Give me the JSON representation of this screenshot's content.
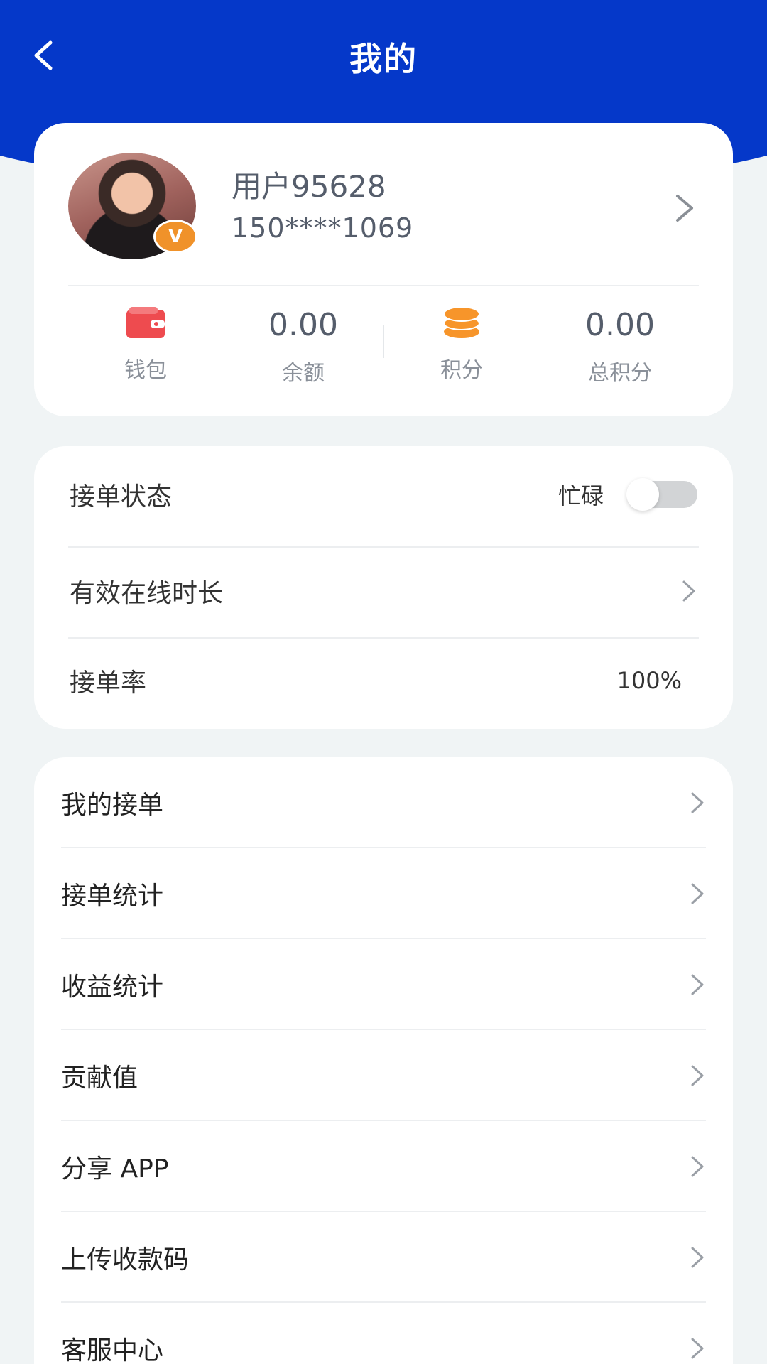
{
  "header": {
    "title": "我的"
  },
  "profile": {
    "username": "用户95628",
    "phone": "150****1069",
    "vip_badge": "V"
  },
  "stats": [
    {
      "type": "icon",
      "icon": "wallet-icon",
      "label": "钱包"
    },
    {
      "type": "value",
      "value": "0.00",
      "label": "余额"
    },
    {
      "type": "icon",
      "icon": "coins-icon",
      "label": "积分"
    },
    {
      "type": "value",
      "value": "0.00",
      "label": "总积分"
    }
  ],
  "status": {
    "order_status_label": "接单状态",
    "busy_label": "忙碌",
    "busy_toggle_on": false,
    "online_duration_label": "有效在线时长",
    "acceptance_rate_label": "接单率",
    "acceptance_rate_value": "100%"
  },
  "menu": [
    {
      "label": "我的接单"
    },
    {
      "label": "接单统计"
    },
    {
      "label": "收益统计"
    },
    {
      "label": "贡献值"
    },
    {
      "label": "分享 APP"
    },
    {
      "label": "上传收款码"
    },
    {
      "label": "客服中心"
    }
  ],
  "colors": {
    "header_blue": "#0538c9",
    "badge_orange": "#f0922a",
    "wallet_red": "#ee4b4f",
    "coin_orange": "#f7952a"
  }
}
